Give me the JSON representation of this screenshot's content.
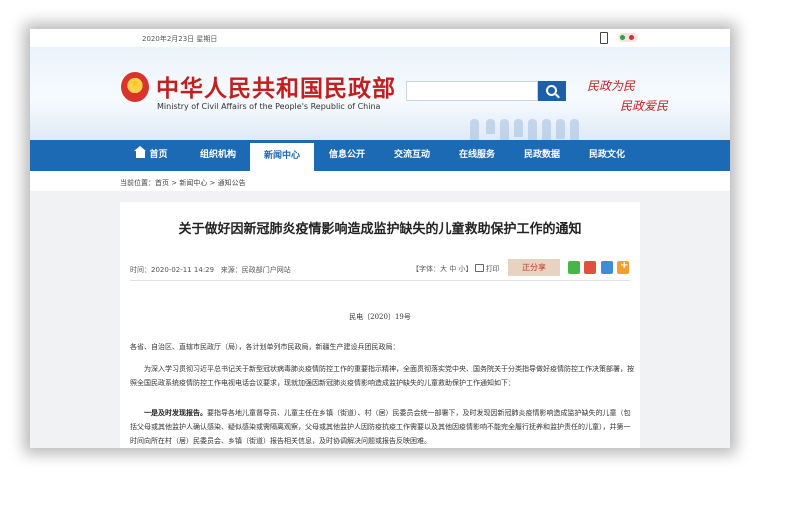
{
  "topbar": {
    "date": "2020年2月23日 星期日"
  },
  "header": {
    "title_cn": "中华人民共和国民政部",
    "title_en": "Ministry of Civil Affairs of the People's Republic of China",
    "search": {
      "placeholder": ""
    },
    "slogan_line1": "民政为民",
    "slogan_line2": "民政爱民"
  },
  "nav": {
    "items": [
      {
        "label": "首页"
      },
      {
        "label": "组织机构"
      },
      {
        "label": "新闻中心"
      },
      {
        "label": "信息公开"
      },
      {
        "label": "交流互动"
      },
      {
        "label": "在线服务"
      },
      {
        "label": "民政数据"
      },
      {
        "label": "民政文化"
      }
    ],
    "active_index": 2
  },
  "breadcrumb": "当前位置：首页 > 新闻中心 > 通知公告",
  "article": {
    "title": "关于做好因新冠肺炎疫情影响造成监护缺失的儿童救助保护工作的通知",
    "time": "时间：2020-02-11 14:29",
    "source": "来源：民政部门户网站",
    "font_tools": "【字体：大 中 小】",
    "print_label": "打印",
    "share_label": "正分享",
    "doc_no": "民电〔2020〕19号",
    "salutation": "各省、自治区、直辖市民政厅（局），各计划单列市民政局，新疆生产建设兵团民政局：",
    "intro": "为深入学习贯彻习近平总书记关于新型冠状病毒肺炎疫情防控工作的重要指示精神，全面贯彻落实党中央、国务院关于分类指导做好疫情防控工作决策部署，按照全国民政系统疫情防控工作电视电话会议要求，现就加强因新冠肺炎疫情影响造成监护缺失的儿童救助保护工作通知如下：",
    "section1_heading": "一是及时发现报告。",
    "section1_body": "要指导各地儿童督导员、儿童主任在乡镇（街道）、村（居）民委员会统一部署下，及时发现因新冠肺炎疫情影响造成监护缺失的儿童（包括父母或其他监护人确认感染、疑似感染或需隔离观察，父母或其他监护人因防疫抗疫工作需要以及其他因疫情影响不能完全履行抚养和监护责任的儿童），并第一时间向所在村（居）民委员会、乡镇（街道）报告相关信息，及时协调解决问题或报告反映困难。"
  },
  "colors": {
    "nav_blue": "#1c69b4",
    "title_red": "#c21f1f",
    "search_blue": "#1d5fa8"
  },
  "icons": [
    "phone-icon",
    "weibo-icon",
    "search-icon",
    "home-icon",
    "print-icon",
    "wechat-icon",
    "weibo-share-icon",
    "qzone-icon",
    "plus-icon",
    "national-emblem"
  ]
}
